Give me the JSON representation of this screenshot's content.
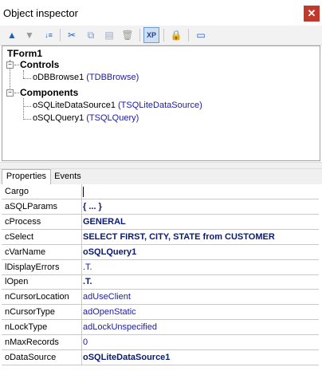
{
  "window": {
    "title": "Object inspector",
    "close_glyph": "✕"
  },
  "toolbar": {
    "buttons": [
      {
        "name": "move-up-icon",
        "glyph": "▲",
        "color": "#1f5fbf"
      },
      {
        "name": "move-down-icon",
        "glyph": "▼",
        "color": "#9a9a9a"
      },
      {
        "name": "sort-icon",
        "glyph": "↓≡",
        "color": "#1f5fbf"
      },
      {
        "name": "cut-icon",
        "glyph": "✂",
        "color": "#1f5fbf"
      },
      {
        "name": "copy-icon",
        "glyph": "⧉",
        "color": "#7a9cc9"
      },
      {
        "name": "paste-icon",
        "glyph": "▤",
        "color": "#9aaac0"
      },
      {
        "name": "delete-icon",
        "glyph": "🗑",
        "color": "#9a9a9a"
      },
      {
        "name": "xp-style-icon",
        "glyph": "XP",
        "color": "#1f3f8f"
      },
      {
        "name": "lock-icon",
        "glyph": "🔒",
        "color": "#c89a1e"
      },
      {
        "name": "window-icon",
        "glyph": "▭",
        "color": "#1f5fbf"
      }
    ]
  },
  "tree": {
    "root": "TForm1",
    "groups": [
      {
        "label": "Controls",
        "children": [
          {
            "object": "oDBBrowse1",
            "class": "(TDBBrowse)"
          }
        ]
      },
      {
        "label": "Components",
        "children": [
          {
            "object": "oSQLiteDataSource1",
            "class": "(TSQLiteDataSource)"
          },
          {
            "object": "oSQLQuery1",
            "class": "(TSQLQuery)"
          }
        ]
      }
    ]
  },
  "tabs": [
    "Properties",
    "Events"
  ],
  "properties": [
    {
      "name": "Cargo",
      "value": "",
      "bold": false,
      "cursor": true
    },
    {
      "name": "aSQLParams",
      "value": "{ ... }",
      "bold": true
    },
    {
      "name": "cProcess",
      "value": "GENERAL",
      "bold": true
    },
    {
      "name": "cSelect",
      "value": "SELECT FIRST, CITY, STATE from CUSTOMER",
      "bold": true
    },
    {
      "name": "cVarName",
      "value": "oSQLQuery1",
      "bold": true
    },
    {
      "name": "lDisplayErrors",
      "value": ".T.",
      "bold": false
    },
    {
      "name": "lOpen",
      "value": ".T.",
      "bold": true
    },
    {
      "name": "nCursorLocation",
      "value": "adUseClient",
      "bold": false
    },
    {
      "name": "nCursorType",
      "value": "adOpenStatic",
      "bold": false
    },
    {
      "name": "nLockType",
      "value": "adLockUnspecified",
      "bold": false
    },
    {
      "name": "nMaxRecords",
      "value": "0",
      "bold": false
    },
    {
      "name": "oDataSource",
      "value": "oSQLiteDataSource1",
      "bold": true
    }
  ]
}
